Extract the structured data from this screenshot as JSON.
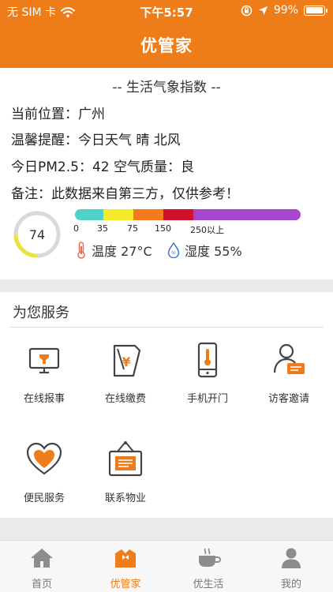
{
  "status_bar": {
    "carrier": "无 SIM 卡",
    "time": "下午5:57",
    "battery": "99%",
    "battery_level": 0.99
  },
  "app": {
    "title": "优管家"
  },
  "weather": {
    "title": "-- 生活气象指数 --",
    "location": "当前位置：广州",
    "reminder": "温馨提醒：今日天气 晴 北风",
    "pm25": "今日PM2.5：42 空气质量：良",
    "note": "备注：此数据来自第三方，仅供参考！",
    "aqi_value": "74",
    "aqi_fraction": 0.25,
    "aqi_scale": {
      "ticks": [
        "0",
        "35",
        "75",
        "150",
        "250以上"
      ],
      "colors": [
        "#4fd3c9",
        "#f5ea2a",
        "#f57a1e",
        "#d4112a",
        "#a646cf"
      ]
    },
    "temperature": "温度 27°C",
    "humidity": "湿度 55%"
  },
  "services": {
    "title": "为您服务",
    "items": [
      {
        "label": "在线报事",
        "icon": "monitor-wrench-icon"
      },
      {
        "label": "在线缴费",
        "icon": "payment-receipt-icon"
      },
      {
        "label": "手机开门",
        "icon": "phone-key-icon"
      },
      {
        "label": "访客邀请",
        "icon": "visitor-card-icon"
      },
      {
        "label": "便民服务",
        "icon": "heart-icon"
      },
      {
        "label": "联系物业",
        "icon": "signboard-icon"
      }
    ]
  },
  "tabs": [
    {
      "label": "首页",
      "icon": "home-icon",
      "active": false
    },
    {
      "label": "优管家",
      "icon": "butler-icon",
      "active": true
    },
    {
      "label": "优生活",
      "icon": "coffee-cup-icon",
      "active": false
    },
    {
      "label": "我的",
      "icon": "person-icon",
      "active": false
    }
  ],
  "colors": {
    "accent": "#ee7d19",
    "aqi_ring": "#f0e03a"
  }
}
